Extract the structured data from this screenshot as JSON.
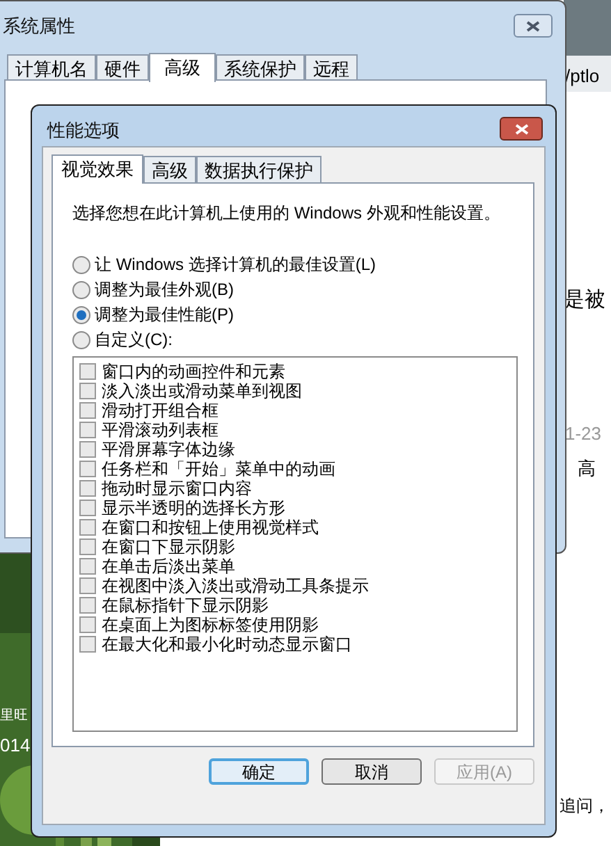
{
  "background_texts": [
    {
      "text": "/ptlo"
    },
    {
      "text": "是被"
    },
    {
      "text": "1-23"
    },
    {
      "text": "高"
    },
    {
      "text": "追问，"
    },
    {
      "text": "里旺"
    },
    {
      "text": "014"
    }
  ],
  "system_properties": {
    "title": "系统属性",
    "tabs": [
      {
        "label": "计算机名",
        "selected": false
      },
      {
        "label": "硬件",
        "selected": false
      },
      {
        "label": "高级",
        "selected": true
      },
      {
        "label": "系统保护",
        "selected": false
      },
      {
        "label": "远程",
        "selected": false
      }
    ]
  },
  "performance_options": {
    "title": "性能选项",
    "tabs": [
      {
        "label": "视觉效果",
        "selected": true
      },
      {
        "label": "高级",
        "selected": false
      },
      {
        "label": "数据执行保护",
        "selected": false
      }
    ],
    "description": "选择您想在此计算机上使用的 Windows 外观和性能设置。",
    "options": [
      {
        "label": "让 Windows 选择计算机的最佳设置(L)",
        "selected": false
      },
      {
        "label": "调整为最佳外观(B)",
        "selected": false
      },
      {
        "label": "调整为最佳性能(P)",
        "selected": true
      },
      {
        "label": "自定义(C):",
        "selected": false
      }
    ],
    "effects": [
      {
        "label": "窗口内的动画控件和元素",
        "checked": false
      },
      {
        "label": "淡入淡出或滑动菜单到视图",
        "checked": false
      },
      {
        "label": "滑动打开组合框",
        "checked": false
      },
      {
        "label": "平滑滚动列表框",
        "checked": false
      },
      {
        "label": "平滑屏幕字体边缘",
        "checked": false
      },
      {
        "label": "任务栏和「开始」菜单中的动画",
        "checked": false
      },
      {
        "label": "拖动时显示窗口内容",
        "checked": false
      },
      {
        "label": "显示半透明的选择长方形",
        "checked": false
      },
      {
        "label": "在窗口和按钮上使用视觉样式",
        "checked": false
      },
      {
        "label": "在窗口下显示阴影",
        "checked": false
      },
      {
        "label": "在单击后淡出菜单",
        "checked": false
      },
      {
        "label": "在视图中淡入淡出或滑动工具条提示",
        "checked": false
      },
      {
        "label": "在鼠标指针下显示阴影",
        "checked": false
      },
      {
        "label": "在桌面上为图标标签使用阴影",
        "checked": false
      },
      {
        "label": "在最大化和最小化时动态显示窗口",
        "checked": false
      }
    ],
    "buttons": [
      {
        "label": "确定",
        "default": true,
        "disabled": false
      },
      {
        "label": "取消",
        "default": false,
        "disabled": false
      },
      {
        "label": "应用(A)",
        "default": false,
        "disabled": true
      }
    ]
  }
}
